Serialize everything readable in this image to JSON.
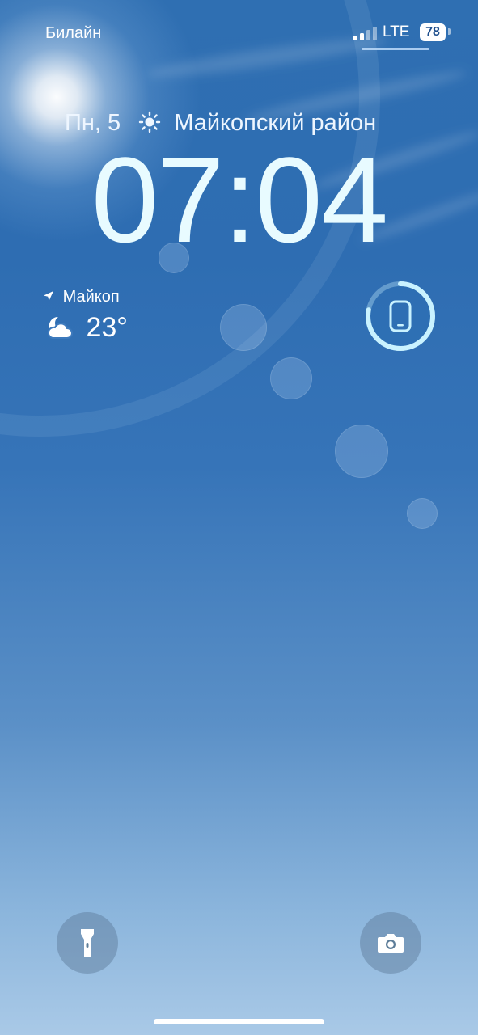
{
  "status_bar": {
    "carrier": "Билайн",
    "network": "LTE",
    "battery_percent": "78",
    "signal_bars_active": 2,
    "signal_bars_total": 4
  },
  "lock_screen": {
    "date": "Пн, 5",
    "weather_icon": "sun-icon",
    "region": "Майкопский район",
    "time": "07:04"
  },
  "weather_widget": {
    "location_icon": "location-arrow-icon",
    "city": "Майкоп",
    "condition_icon": "partly-cloudy-night-icon",
    "temperature": "23°"
  },
  "battery_widget": {
    "device_icon": "iphone-icon",
    "charge_fraction": 0.78
  },
  "bottom_controls": {
    "left_icon": "flashlight-icon",
    "right_icon": "camera-icon"
  },
  "colors": {
    "sky_top": "#2f6fb2",
    "sky_bottom": "#a9c9e7",
    "clock_text": "#e8fbff",
    "ring_accent": "#c9f2ff"
  }
}
